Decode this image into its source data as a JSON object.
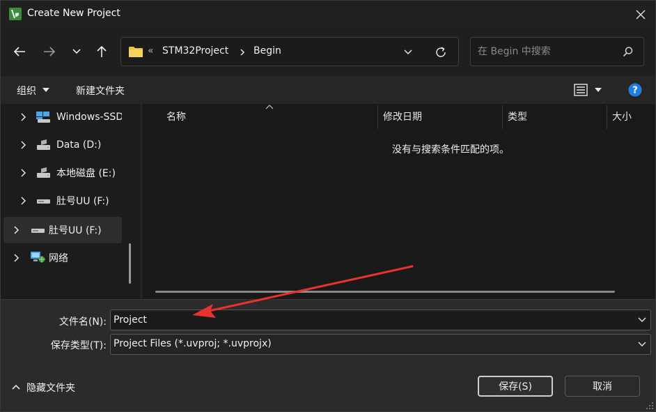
{
  "window": {
    "title": "Create New Project"
  },
  "address_bar": {
    "overflow": "«",
    "crumbs": [
      "STM32Project",
      "Begin"
    ]
  },
  "search": {
    "placeholder": "在 Begin 中搜索"
  },
  "toolbar": {
    "organize_label": "组织",
    "new_folder_label": "新建文件夹"
  },
  "sidebar": {
    "items": [
      {
        "label": "Windows-SSD",
        "icon": "windows-drive-icon"
      },
      {
        "label": "Data (D:)",
        "icon": "drive-icon"
      },
      {
        "label": "本地磁盘 (E:)",
        "icon": "drive-icon"
      },
      {
        "label": "肚号UU (F:)",
        "icon": "usb-drive-icon"
      },
      {
        "label": "肚号UU (F:)",
        "icon": "usb-drive-icon",
        "selected": true
      },
      {
        "label": "网络",
        "icon": "network-icon"
      }
    ]
  },
  "file_list": {
    "columns": [
      "名称",
      "修改日期",
      "类型",
      "大小"
    ],
    "empty_message": "没有与搜索条件匹配的项。"
  },
  "form": {
    "filename_label": "文件名(N):",
    "filename_value": "Project",
    "filetype_label": "保存类型(T):",
    "filetype_value": "Project Files (*.uvproj; *.uvprojx)"
  },
  "footer": {
    "hide_folders_label": "隐藏文件夹",
    "save_label": "保存(S)",
    "cancel_label": "取消"
  },
  "colors": {
    "annotation_arrow": "#e8322f",
    "help_icon": "#1e7fe0",
    "folder_icon": "#f0c040"
  }
}
